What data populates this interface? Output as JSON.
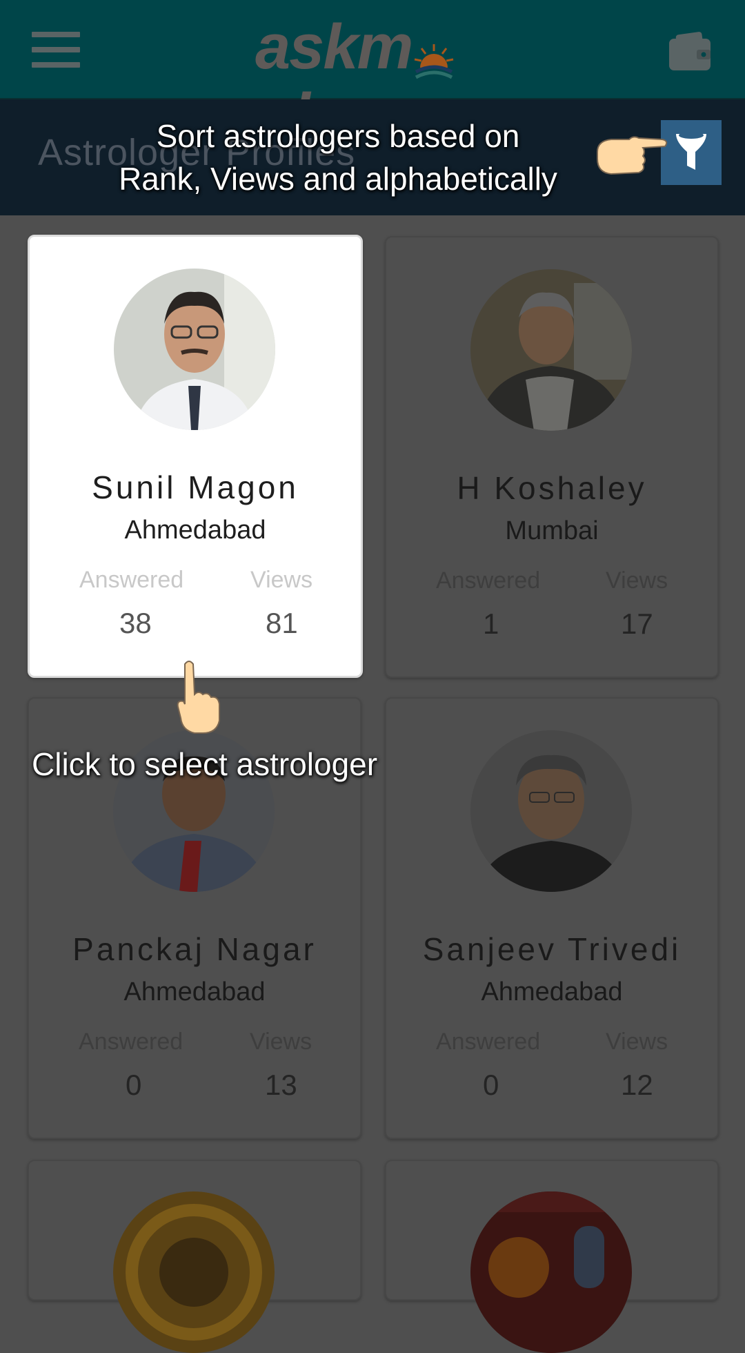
{
  "app": {
    "logo_text_left": "askm",
    "logo_text_right": "nk",
    "brand_color": "#004549"
  },
  "header": {
    "menu_icon": "hamburger-menu-icon",
    "wallet_icon": "wallet-icon"
  },
  "subheader": {
    "title": "Astrologer Profiles",
    "filter_icon": "funnel-filter-icon"
  },
  "coachmarks": {
    "sort_line1": "Sort astrologers based on",
    "sort_line2": "Rank, Views and alphabetically",
    "select": "Click to select astrologer"
  },
  "labels": {
    "answered": "Answered",
    "views": "Views"
  },
  "astrologers": [
    {
      "name": "Sunil Magon",
      "city": "Ahmedabad",
      "answered": "38",
      "views": "81"
    },
    {
      "name": "H Koshaley",
      "city": "Mumbai",
      "answered": "1",
      "views": "17"
    },
    {
      "name": "Panckaj Nagar",
      "city": "Ahmedabad",
      "answered": "0",
      "views": "13"
    },
    {
      "name": "Sanjeev Trivedi",
      "city": "Ahmedabad",
      "answered": "0",
      "views": "12"
    }
  ]
}
